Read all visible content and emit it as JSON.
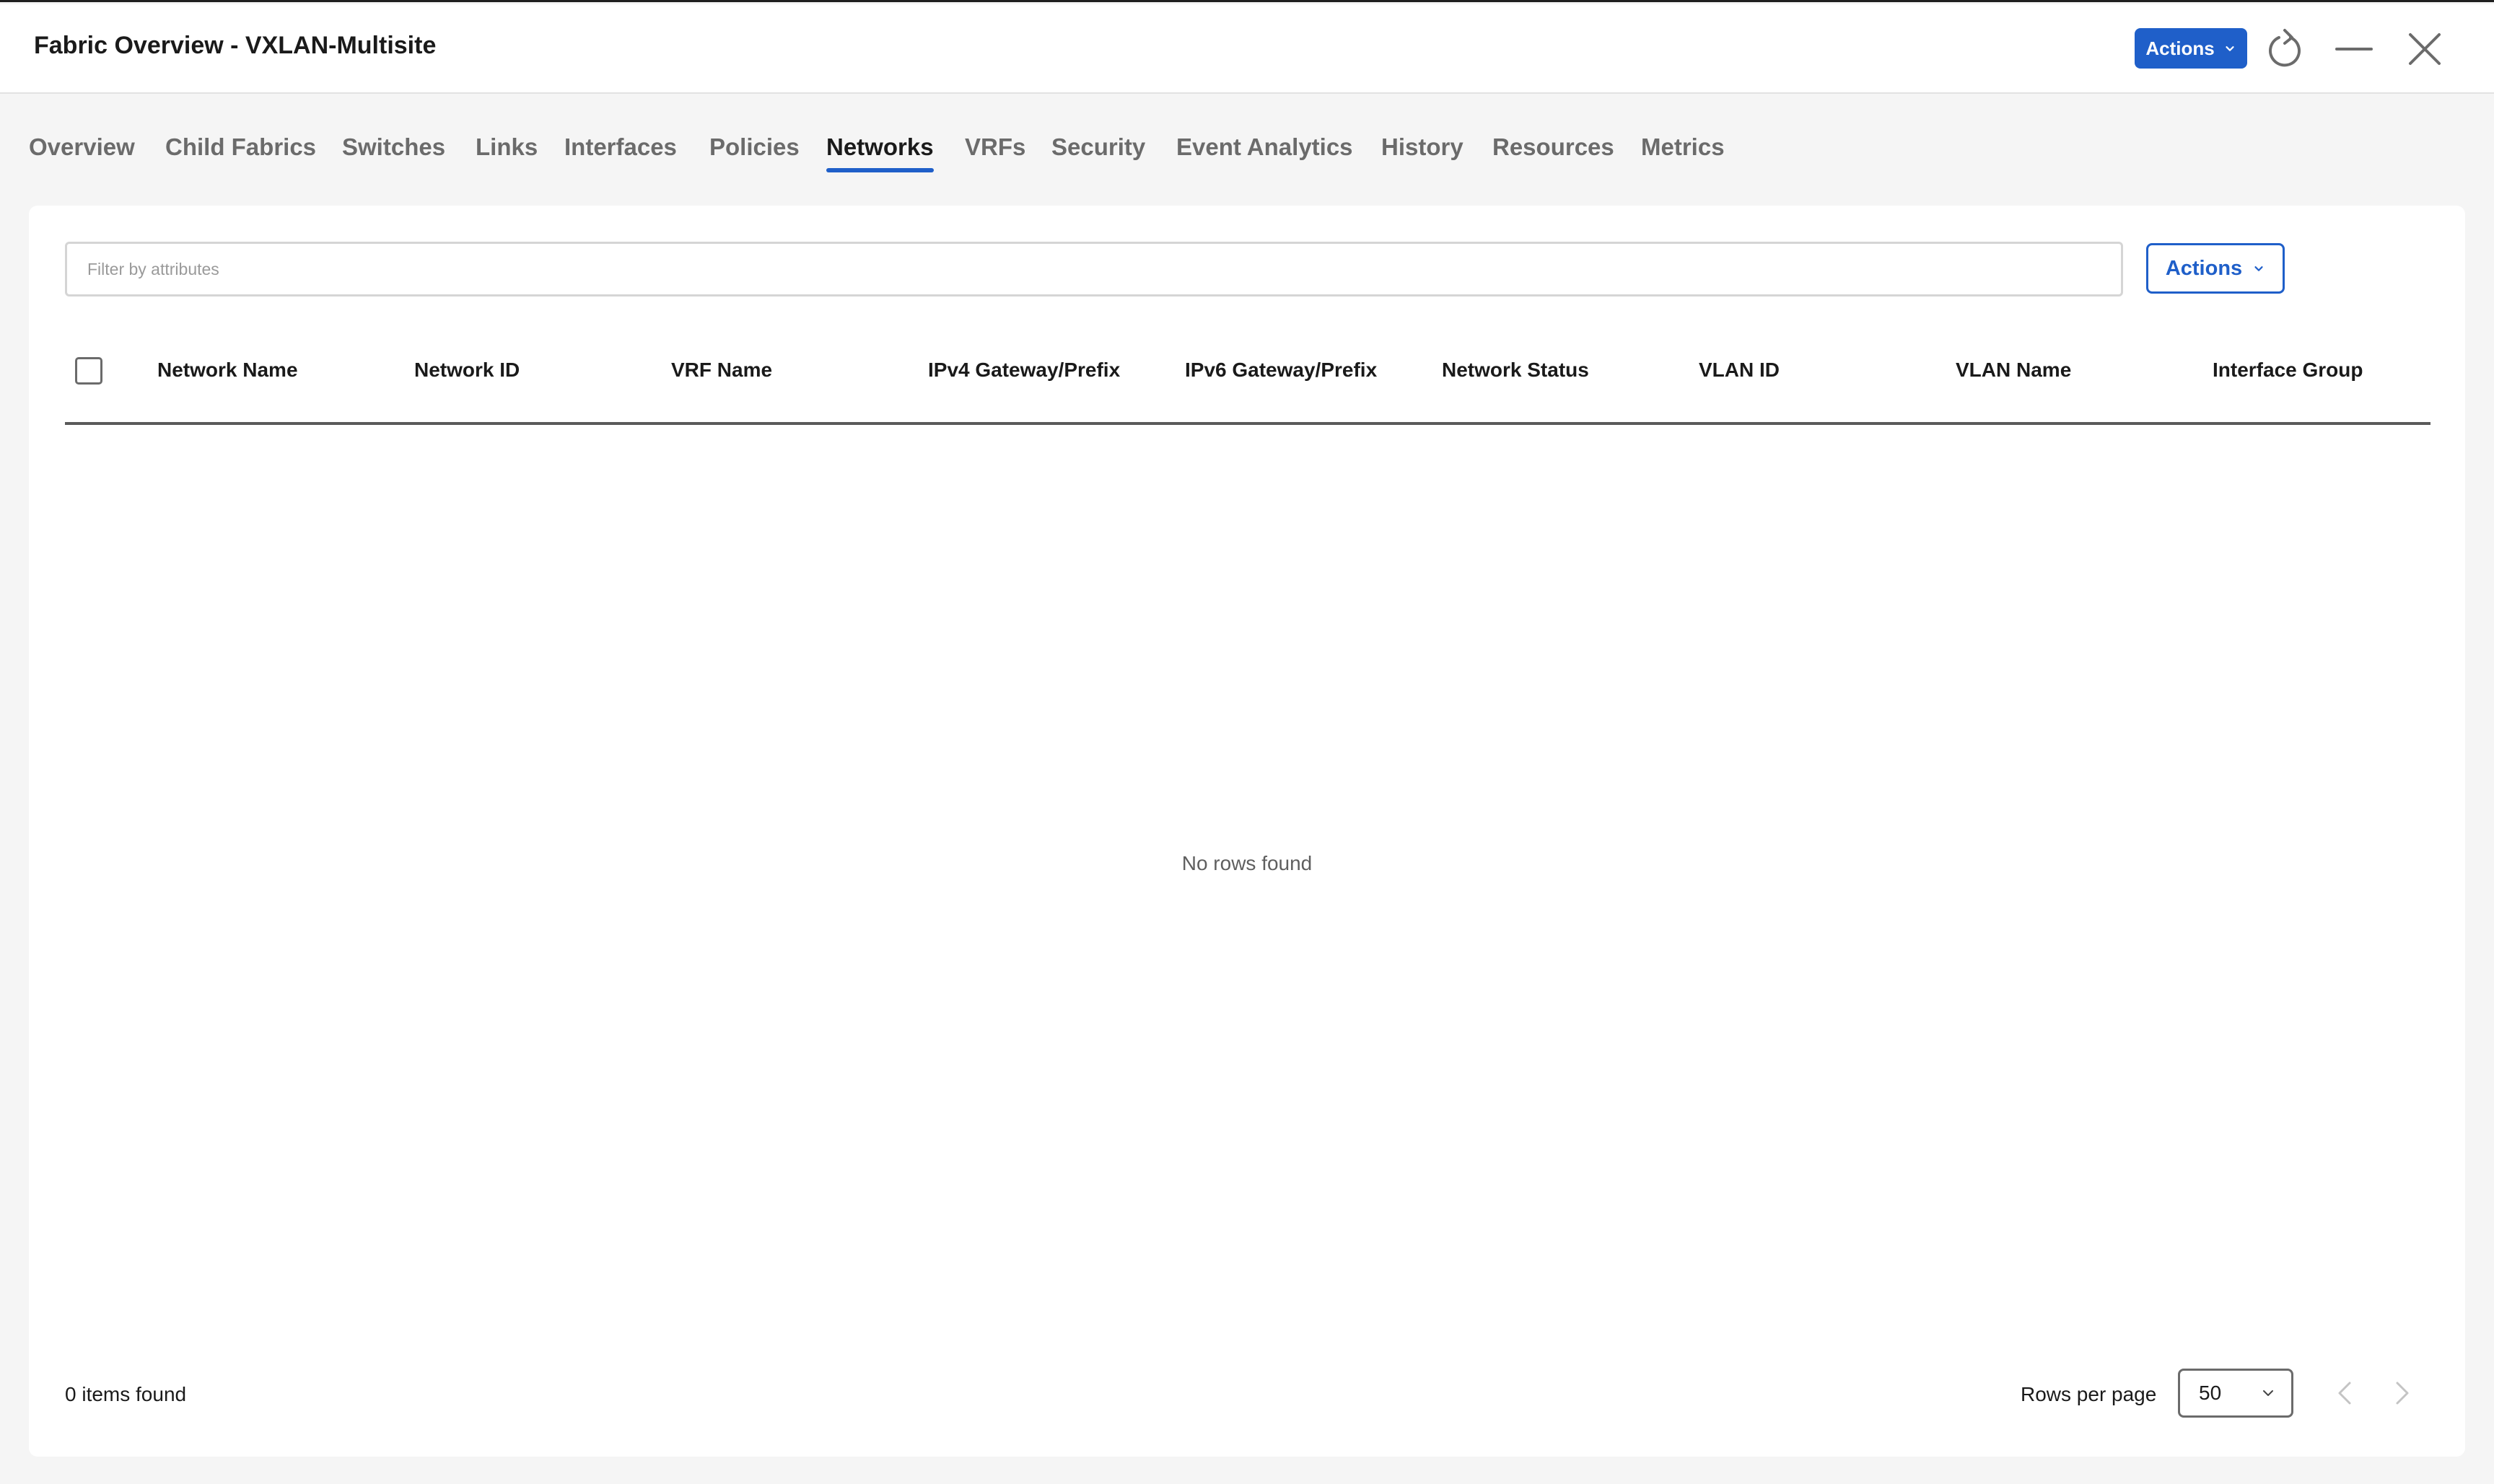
{
  "window": {
    "title": "Fabric Overview - VXLAN-Multisite",
    "actions_label": "Actions",
    "accent_color": "#1f5fc9"
  },
  "tabs": [
    {
      "label": "Overview"
    },
    {
      "label": "Child Fabrics"
    },
    {
      "label": "Switches"
    },
    {
      "label": "Links"
    },
    {
      "label": "Interfaces"
    },
    {
      "label": "Policies"
    },
    {
      "label": "Networks",
      "active": true
    },
    {
      "label": "VRFs"
    },
    {
      "label": "Security"
    },
    {
      "label": "Event Analytics"
    },
    {
      "label": "History"
    },
    {
      "label": "Resources"
    },
    {
      "label": "Metrics"
    }
  ],
  "toolbar": {
    "filter_placeholder": "Filter by attributes",
    "actions_label": "Actions"
  },
  "table": {
    "columns": [
      "Network Name",
      "Network ID",
      "VRF Name",
      "IPv4 Gateway/Prefix",
      "IPv6 Gateway/Prefix",
      "Network Status",
      "VLAN ID",
      "VLAN Name",
      "Interface Group"
    ],
    "rows": [],
    "empty_message": "No rows found"
  },
  "footer": {
    "items_found": "0 items found",
    "rows_per_page_label": "Rows per page",
    "rows_per_page_value": "50"
  },
  "icons": {
    "refresh": "refresh-icon",
    "minimize": "minimize-icon",
    "close": "close-icon",
    "chevron_down": "chevron-down-icon",
    "chevron_left": "chevron-left-icon",
    "chevron_right": "chevron-right-icon"
  }
}
